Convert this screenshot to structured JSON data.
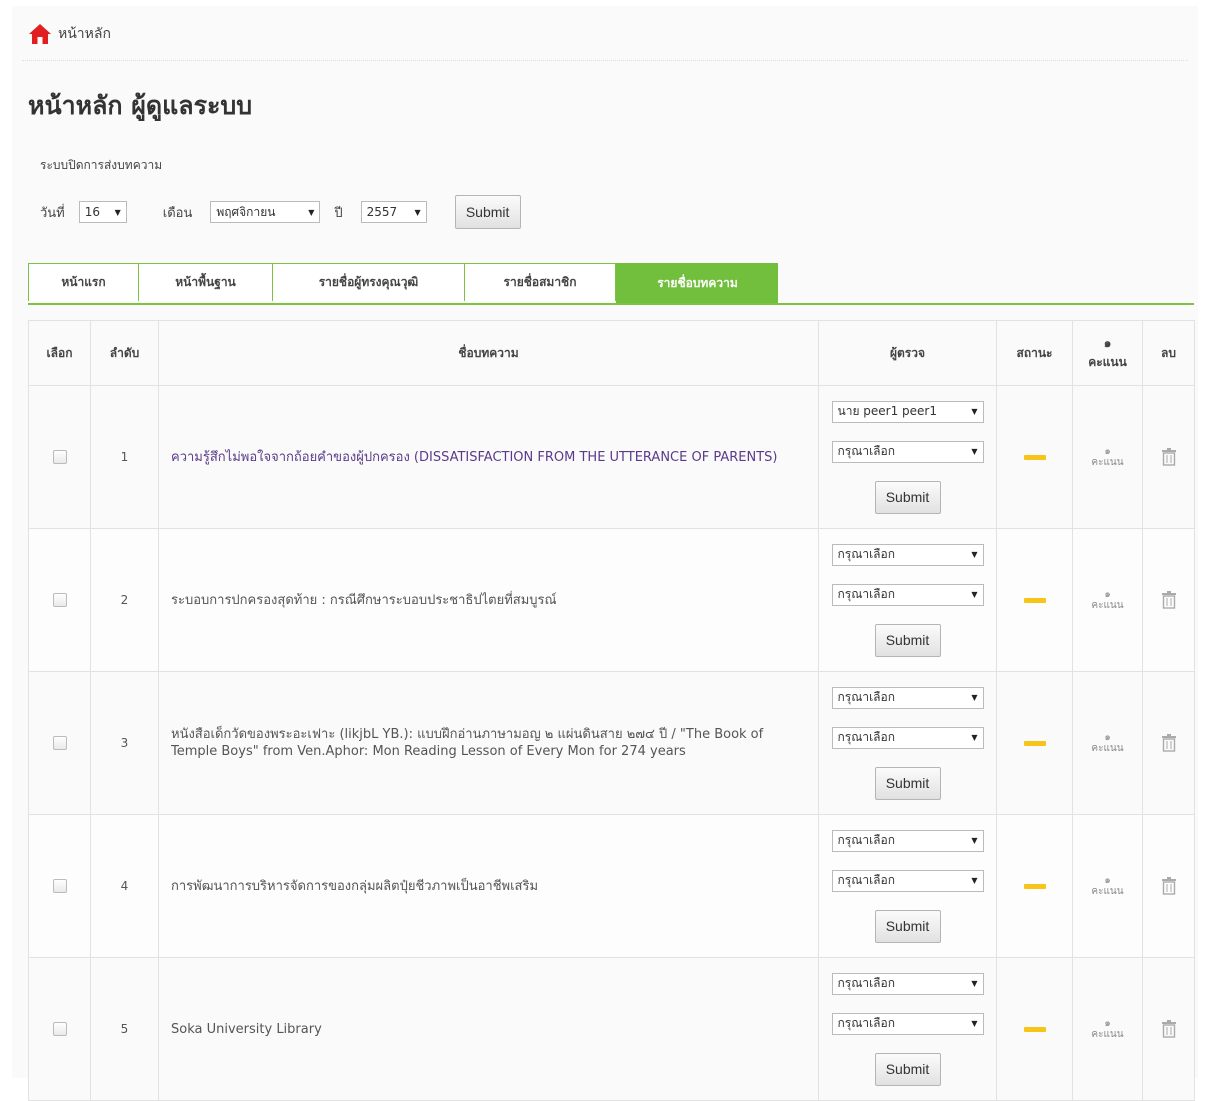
{
  "breadcrumb": {
    "home_label": "หน้าหลัก"
  },
  "page_title": "หน้าหลัก ผู้ดูแลระบบ",
  "close_submission": {
    "label": "ระบบปิดการส่งบทความ",
    "day_label": "วันที่",
    "day_value": "16",
    "month_label": "เดือน",
    "month_value": "พฤศจิกายน",
    "year_label": "ปี",
    "year_value": "2557",
    "submit_label": "Submit"
  },
  "tabs": [
    {
      "label": "หน้าแรก",
      "active": false
    },
    {
      "label": "หน้าพื้นฐาน",
      "active": false
    },
    {
      "label": "รายชื่อผู้ทรงคุณวุฒิ",
      "active": false
    },
    {
      "label": "รายชื่อสมาชิก",
      "active": false
    },
    {
      "label": "รายชื่อบทความ",
      "active": true
    }
  ],
  "table": {
    "headers": {
      "select": "เลือก",
      "order": "ลำดับ",
      "article": "ชื่อบทความ",
      "reviewer": "ผู้ตรวจ",
      "status": "สถานะ",
      "score_icon": "๑",
      "score": "คะแนน",
      "delete": "ลบ"
    },
    "rows": [
      {
        "order": "1",
        "title": "ความรู้สึกไม่พอใจจากถ้อยคำของผู้ปกครอง (DISSATISFACTION FROM THE UTTERANCE OF PARENTS)",
        "is_link": true,
        "reviewer1": "นาย peer1 peer1",
        "reviewer2": "กรุณาเลือก",
        "submit": "Submit",
        "score_icon": "๑",
        "score": "คะแนน"
      },
      {
        "order": "2",
        "title": "ระบอบการปกครองสุดท้าย : กรณีศึกษาระบอบประชาธิปไตยที่สมบูรณ์",
        "is_link": false,
        "reviewer1": "กรุณาเลือก",
        "reviewer2": "กรุณาเลือก",
        "submit": "Submit",
        "score_icon": "๑",
        "score": "คะแนน"
      },
      {
        "order": "3",
        "title": "หนังสือเด็กวัดของพระอะเฟาะ (likjbL YB.): แบบฝึกอ่านภาษามอญ ๒ แผ่นดินสาย ๒๗๔ ปี / \"The Book of Temple Boys\" from Ven.Aphor: Mon Reading Lesson of Every Mon for 274 years",
        "is_link": false,
        "reviewer1": "กรุณาเลือก",
        "reviewer2": "กรุณาเลือก",
        "submit": "Submit",
        "score_icon": "๑",
        "score": "คะแนน"
      },
      {
        "order": "4",
        "title": "การพัฒนาการบริหารจัดการของกลุ่มผลิตปุ๋ยชีวภาพเป็นอาชีพเสริม",
        "is_link": false,
        "reviewer1": "กรุณาเลือก",
        "reviewer2": "กรุณาเลือก",
        "submit": "Submit",
        "score_icon": "๑",
        "score": "คะแนน"
      },
      {
        "order": "5",
        "title": "Soka University Library",
        "is_link": false,
        "reviewer1": "กรุณาเลือก",
        "reviewer2": "กรุณาเลือก",
        "submit": "Submit",
        "score_icon": "๑",
        "score": "คะแนน"
      }
    ]
  },
  "colors": {
    "tab_accent": "#71bf3c",
    "status_pending": "#f5c518",
    "home_icon": "#e02020",
    "link": "#5b3a8a"
  }
}
